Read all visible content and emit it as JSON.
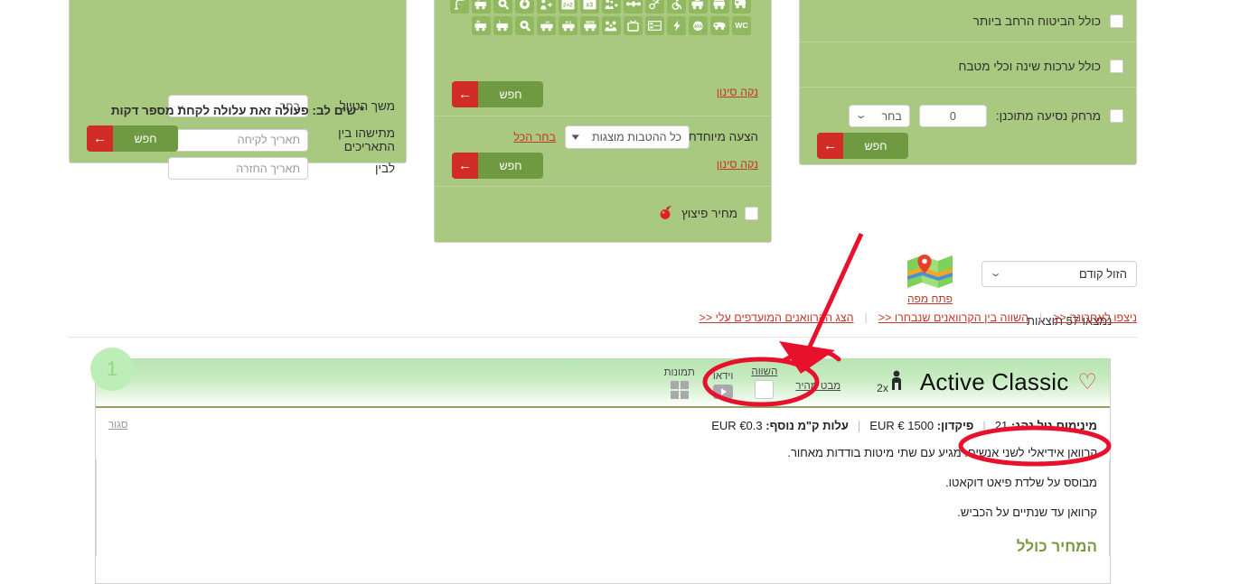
{
  "filters": {
    "left_panel": {
      "rows": [
        {
          "label": "משך הטיול",
          "value": "בחר",
          "type": "select"
        },
        {
          "label": "מתישהו בין התאריכים",
          "value": "תאריך לקיחה",
          "type": "date"
        },
        {
          "label": "לבין",
          "value": "תאריך החזרה",
          "type": "date"
        }
      ],
      "note": "* שים לב: פעולה זאת עלולה לקחת מספר דקות",
      "search_label": "חפש"
    },
    "mid_panel": {
      "icons": [
        {
          "name": "van-icon",
          "glyph": "van"
        },
        {
          "name": "camper-icon",
          "glyph": "camper"
        },
        {
          "name": "camper-alt-icon",
          "glyph": "camper"
        },
        {
          "name": "wheelchair-icon",
          "glyph": "wheelchair"
        },
        {
          "name": "automatic-key-icon",
          "glyph": "key-a"
        },
        {
          "name": "tow-hitch-icon",
          "glyph": "hitch"
        },
        {
          "name": "family-plus-icon",
          "glyph": "family-plus"
        },
        {
          "name": "capacity-x3-icon",
          "glyph": "x3"
        },
        {
          "name": "capacity-2plus2-icon",
          "glyph": "2+2"
        },
        {
          "name": "person-plus-icon",
          "glyph": "person-plus"
        },
        {
          "name": "circle-icon",
          "glyph": "circle"
        },
        {
          "name": "quality-y-icon",
          "glyph": "q-y"
        },
        {
          "name": "camper-size-s-icon",
          "glyph": "camper-s"
        },
        {
          "name": "shower-icon",
          "glyph": "shower"
        },
        {
          "name": "wc-icon",
          "glyph": "wc"
        },
        {
          "name": "trailer-icon",
          "glyph": "trailer"
        },
        {
          "name": "four-by-four-icon",
          "glyph": "4x4"
        },
        {
          "name": "electricity-icon",
          "glyph": "bolt"
        },
        {
          "name": "bunk-bed-icon",
          "glyph": "bunk"
        },
        {
          "name": "tv-icon",
          "glyph": "tv"
        },
        {
          "name": "family-icon",
          "glyph": "family"
        },
        {
          "name": "new-icon",
          "glyph": "new"
        },
        {
          "name": "age-0-1-icon",
          "glyph": "0-1"
        },
        {
          "name": "age-plus4-icon",
          "glyph": "+4"
        },
        {
          "name": "quality-c-icon",
          "glyph": "q-c"
        },
        {
          "name": "camper-size-l-icon",
          "glyph": "camper-l"
        },
        {
          "name": "camper-size-m-icon",
          "glyph": "camper-m"
        }
      ],
      "clear_filter_1": "נקה סינון",
      "search_label_1": "חפש",
      "special_offer_label": "הצעה מיוחדת",
      "special_offer_value": "כל ההטבות מוצגות",
      "select_all": "בחר הכל",
      "clear_filter_2": "נקה סינון",
      "search_label_2": "חפש",
      "blast_price_label": "מחיר פיצוץ",
      "blast_price_checked": false
    },
    "right_panel": {
      "items": [
        {
          "label": "כולל הביטוח הרחב ביותר",
          "checked": false
        },
        {
          "label": "כולל ערכות שינה וכלי מטבח",
          "checked": false
        }
      ],
      "distance_label": "מרחק נסיעה מתוכנן:",
      "distance_value": "0",
      "distance_unit": "בחר",
      "distance_checked": false,
      "search_label": "חפש"
    }
  },
  "toolbar": {
    "sort_value": "הזול קודם",
    "map_link": "פתח מפה",
    "results_count": "נמצאו 57 תוצאות",
    "links": [
      "ניצפו לאחרונה <<",
      "השווה בין הקרוואנים שנבחרו <<",
      "הצג הקרוואנים המועדפים עלי <<"
    ]
  },
  "result_card": {
    "badge": "1",
    "title": "Active Classic",
    "pax": "2x",
    "actions": [
      {
        "label": "מבט מהיר",
        "name": "quick-view-link"
      },
      {
        "label": "השווה",
        "name": "compare-checkbox"
      },
      {
        "label": "וידאו",
        "name": "video-button"
      },
      {
        "label": "תמונות",
        "name": "photos-button"
      }
    ],
    "close_label": "סגור",
    "meta": [
      {
        "label": "מינימום גיל נהג:",
        "value": "21",
        "highlighted": true
      },
      {
        "label": "פיקדון:",
        "value": "1500 € EUR",
        "highlighted": false
      },
      {
        "label": "עלות ק\"מ נוסף:",
        "value": "€0.3 EUR",
        "highlighted": false
      }
    ],
    "description": [
      "קרוואן אידיאלי לשני אנשים. מגיע עם שתי מיטות בודדות מאחור.",
      "מבוסס על שלדת פיאט דוקאטו.",
      "קרוואן עד שנתיים על הכביש."
    ],
    "price_heading": "המחיר כולל"
  },
  "colors": {
    "panel_green": "#a8c97f",
    "icon_green": "#8fb85f",
    "button_green": "#6f9a41",
    "button_red": "#d12d26",
    "link_red": "#c0392b",
    "annotation_red": "#e8112d",
    "price_green": "#7a9a3e"
  }
}
